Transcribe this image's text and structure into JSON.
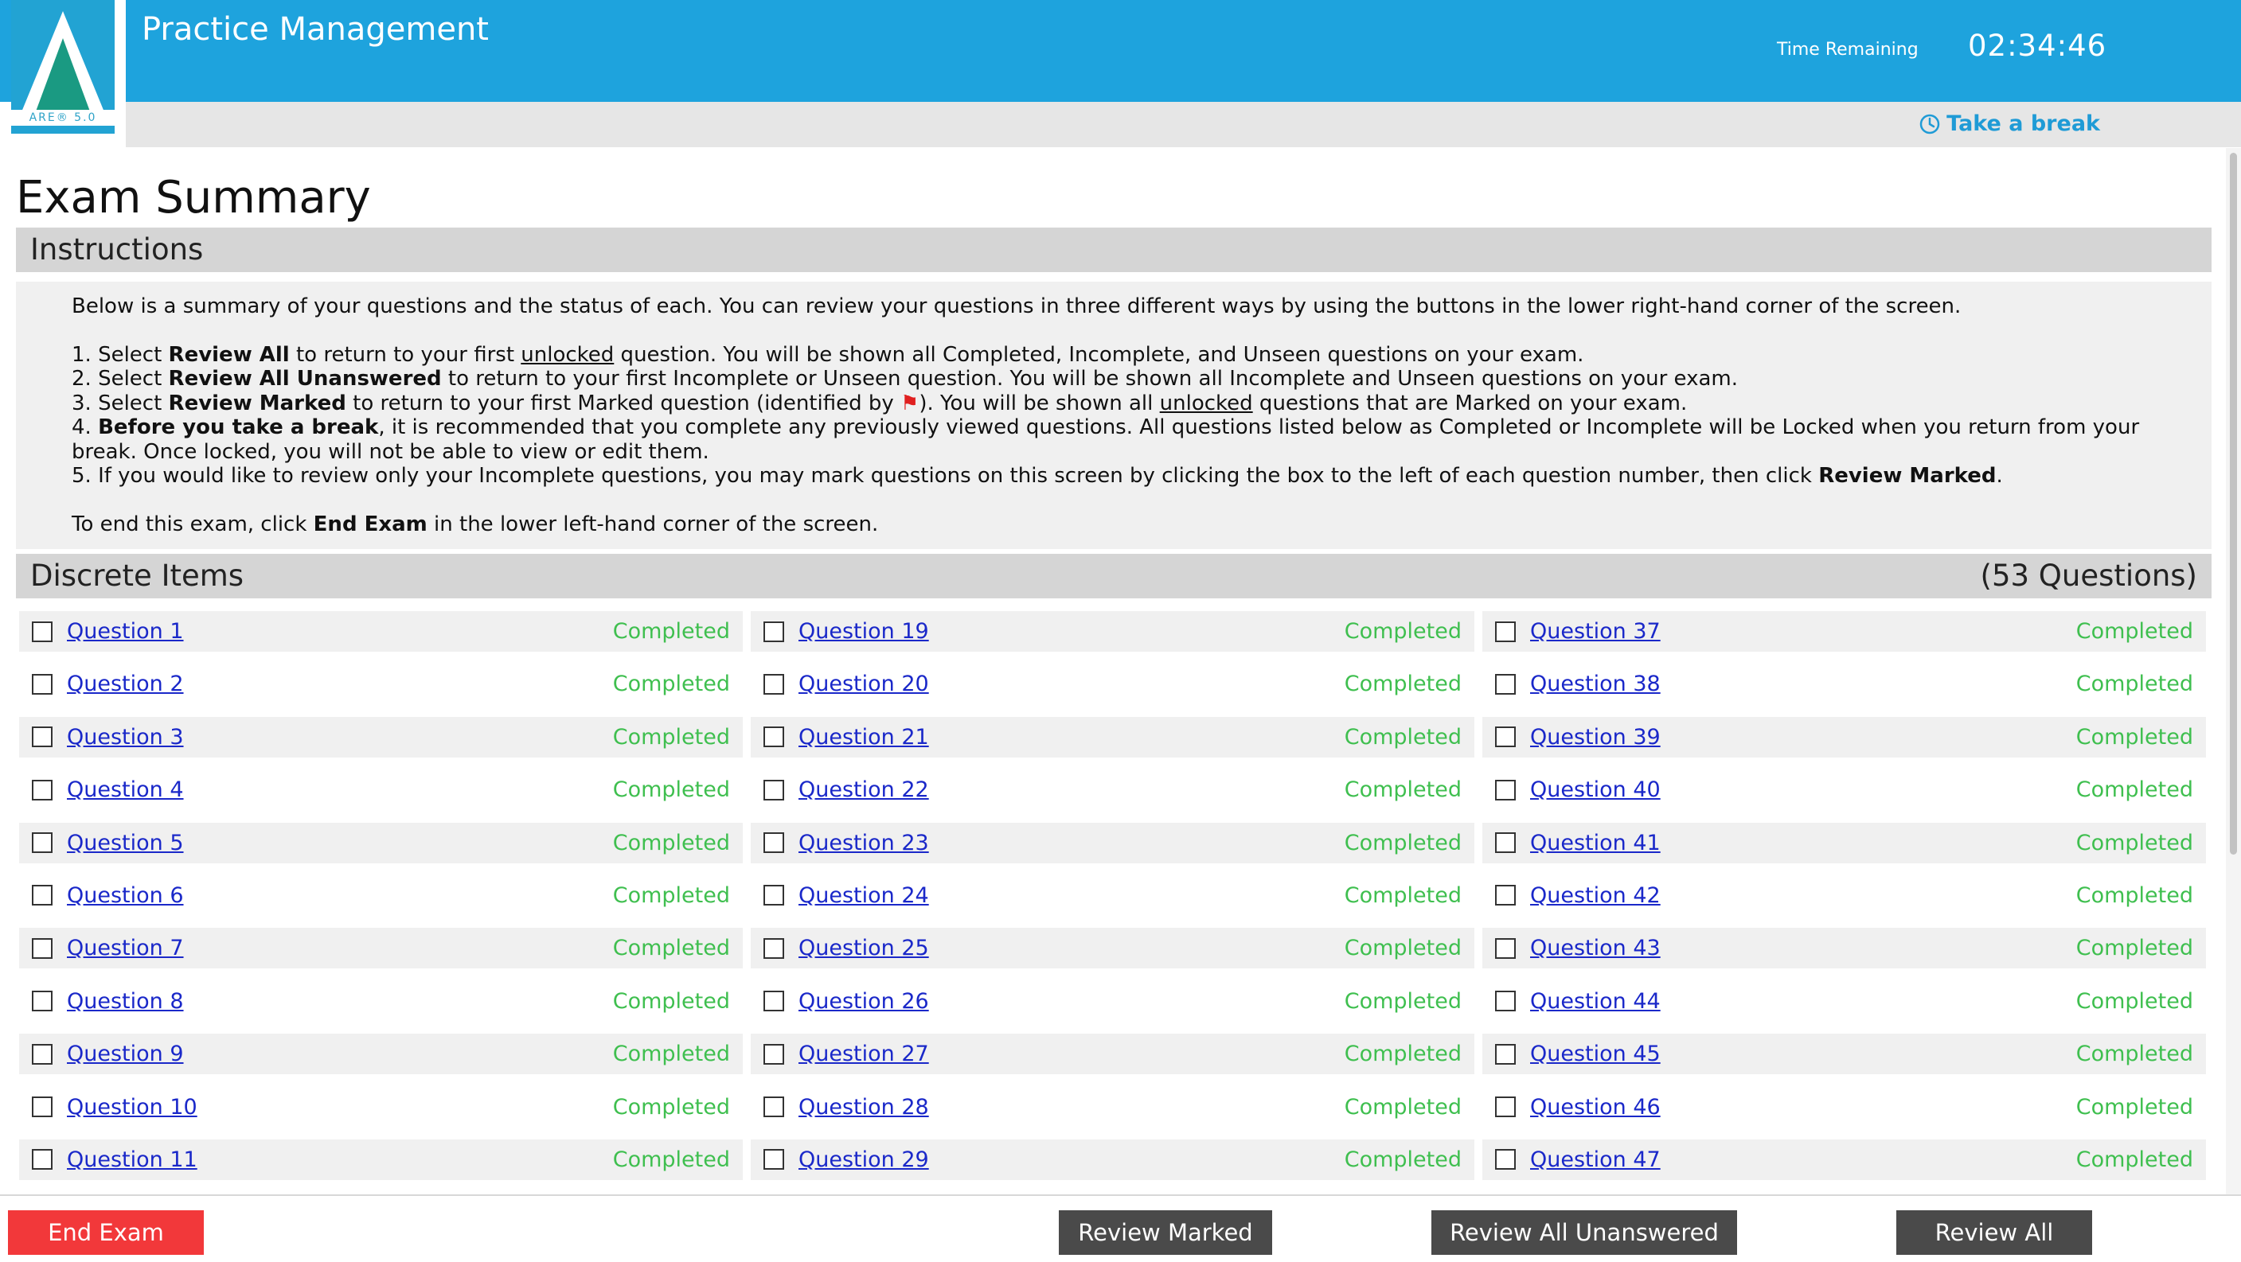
{
  "header": {
    "logo_text": "ARE® 5.0",
    "app_title": "Practice Management",
    "time_label": "Time Remaining",
    "time_value": "02:34:46",
    "break_label": "Take a break"
  },
  "page_title": "Exam Summary",
  "instructions": {
    "heading": "Instructions",
    "intro": "Below is a summary of your questions and the status of each. You can review your questions in three different ways by using the buttons in the lower right-hand corner of the screen.",
    "item1": {
      "a": "1. Select ",
      "b": "Review All",
      "c": " to return to your first ",
      "d": "unlocked",
      "e": " question. You will be shown all Completed, Incomplete, and Unseen questions on your exam."
    },
    "item2": {
      "a": "2. Select ",
      "b": "Review All Unanswered",
      "c": " to return to your first Incomplete or Unseen question. You will be shown all Incomplete and Unseen questions on your exam."
    },
    "item3": {
      "a": "3. Select ",
      "b": "Review Marked",
      "c": " to return to your first Marked question (identified by ",
      "d": "). You will be shown all ",
      "e": "unlocked",
      "f": " questions that are Marked on your exam."
    },
    "item4": {
      "a": "4. ",
      "b": "Before you take a break",
      "c": ", it is recommended that you complete any previously viewed questions. All questions listed below as Completed or Incomplete will be Locked when you return from your break. Once locked, you will not be able to view or edit them."
    },
    "item5": {
      "a": "5. If you would like to review only your Incomplete questions, you may mark questions on this screen by clicking the box to the left of each question number, then click ",
      "b": "Review Marked",
      "c": "."
    },
    "end": {
      "a": "To end this exam, click ",
      "b": "End Exam",
      "c": " in the lower left-hand corner of the screen."
    }
  },
  "discrete": {
    "heading": "Discrete Items",
    "count": "(53 Questions)",
    "columns": [
      [
        {
          "label": "Question 1",
          "status": "Completed"
        },
        {
          "label": "Question 2",
          "status": "Completed"
        },
        {
          "label": "Question 3",
          "status": "Completed"
        },
        {
          "label": "Question 4",
          "status": "Completed"
        },
        {
          "label": "Question 5",
          "status": "Completed"
        },
        {
          "label": "Question 6",
          "status": "Completed"
        },
        {
          "label": "Question 7",
          "status": "Completed"
        },
        {
          "label": "Question 8",
          "status": "Completed"
        },
        {
          "label": "Question 9",
          "status": "Completed"
        },
        {
          "label": "Question 10",
          "status": "Completed"
        },
        {
          "label": "Question 11",
          "status": "Completed"
        }
      ],
      [
        {
          "label": "Question 19",
          "status": "Completed"
        },
        {
          "label": "Question 20",
          "status": "Completed"
        },
        {
          "label": "Question 21",
          "status": "Completed"
        },
        {
          "label": "Question 22",
          "status": "Completed"
        },
        {
          "label": "Question 23",
          "status": "Completed"
        },
        {
          "label": "Question 24",
          "status": "Completed"
        },
        {
          "label": "Question 25",
          "status": "Completed"
        },
        {
          "label": "Question 26",
          "status": "Completed"
        },
        {
          "label": "Question 27",
          "status": "Completed"
        },
        {
          "label": "Question 28",
          "status": "Completed"
        },
        {
          "label": "Question 29",
          "status": "Completed"
        }
      ],
      [
        {
          "label": "Question 37",
          "status": "Completed"
        },
        {
          "label": "Question 38",
          "status": "Completed"
        },
        {
          "label": "Question 39",
          "status": "Completed"
        },
        {
          "label": "Question 40",
          "status": "Completed"
        },
        {
          "label": "Question 41",
          "status": "Completed"
        },
        {
          "label": "Question 42",
          "status": "Completed"
        },
        {
          "label": "Question 43",
          "status": "Completed"
        },
        {
          "label": "Question 44",
          "status": "Completed"
        },
        {
          "label": "Question 45",
          "status": "Completed"
        },
        {
          "label": "Question 46",
          "status": "Completed"
        },
        {
          "label": "Question 47",
          "status": "Completed"
        }
      ]
    ]
  },
  "footer": {
    "end_exam": "End Exam",
    "review_marked": "Review Marked",
    "review_unanswered": "Review All Unanswered",
    "review_all": "Review All"
  },
  "colors": {
    "header_bg": "#1ea3dd",
    "status_completed": "#3fbf4f",
    "link": "#1a28c9",
    "end_button": "#f2383a",
    "nav_button": "#4a4a4a"
  },
  "icons": {
    "logo": "are-triangle-logo",
    "break": "clock-icon",
    "marked": "red-flag-icon"
  }
}
